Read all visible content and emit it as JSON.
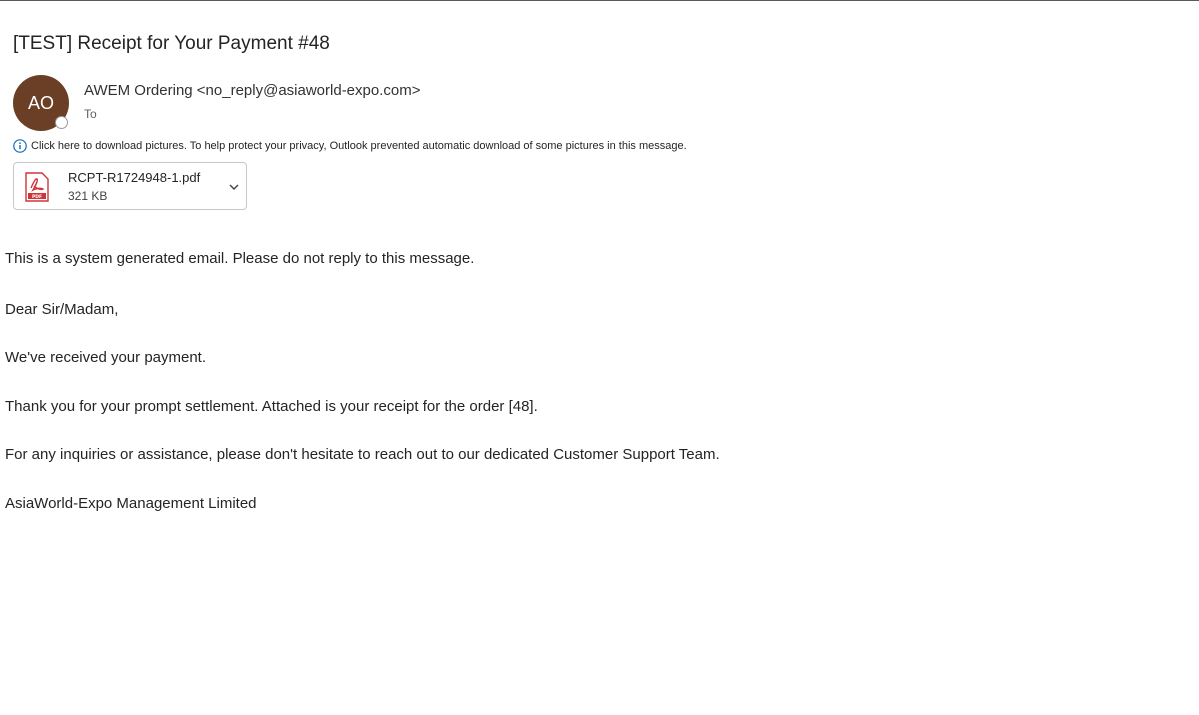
{
  "email": {
    "subject": "[TEST] Receipt for Your Payment #48",
    "sender": {
      "initials": "AO",
      "display": "AWEM Ordering <no_reply@asiaworld-expo.com>",
      "avatar_color": "#6b3e26"
    },
    "to_label": "To",
    "privacy_notice": "Click here to download pictures. To help protect your privacy, Outlook prevented automatic download of some pictures in this message.",
    "attachment": {
      "filename": "RCPT-R1724948-1.pdf",
      "size": "321 KB",
      "icon": "pdf-icon",
      "icon_color": "#d13438"
    },
    "body": {
      "line1": "This is a system generated email. Please do not reply to this message.",
      "line2": "Dear Sir/Madam,",
      "line3": "We've received your payment.",
      "line4": "Thank you for your prompt settlement. Attached is your receipt for the order [48].",
      "line5": "For any inquiries or assistance, please don't hesitate to reach out to our dedicated Customer Support Team.",
      "line6": "AsiaWorld-Expo Management Limited"
    }
  }
}
